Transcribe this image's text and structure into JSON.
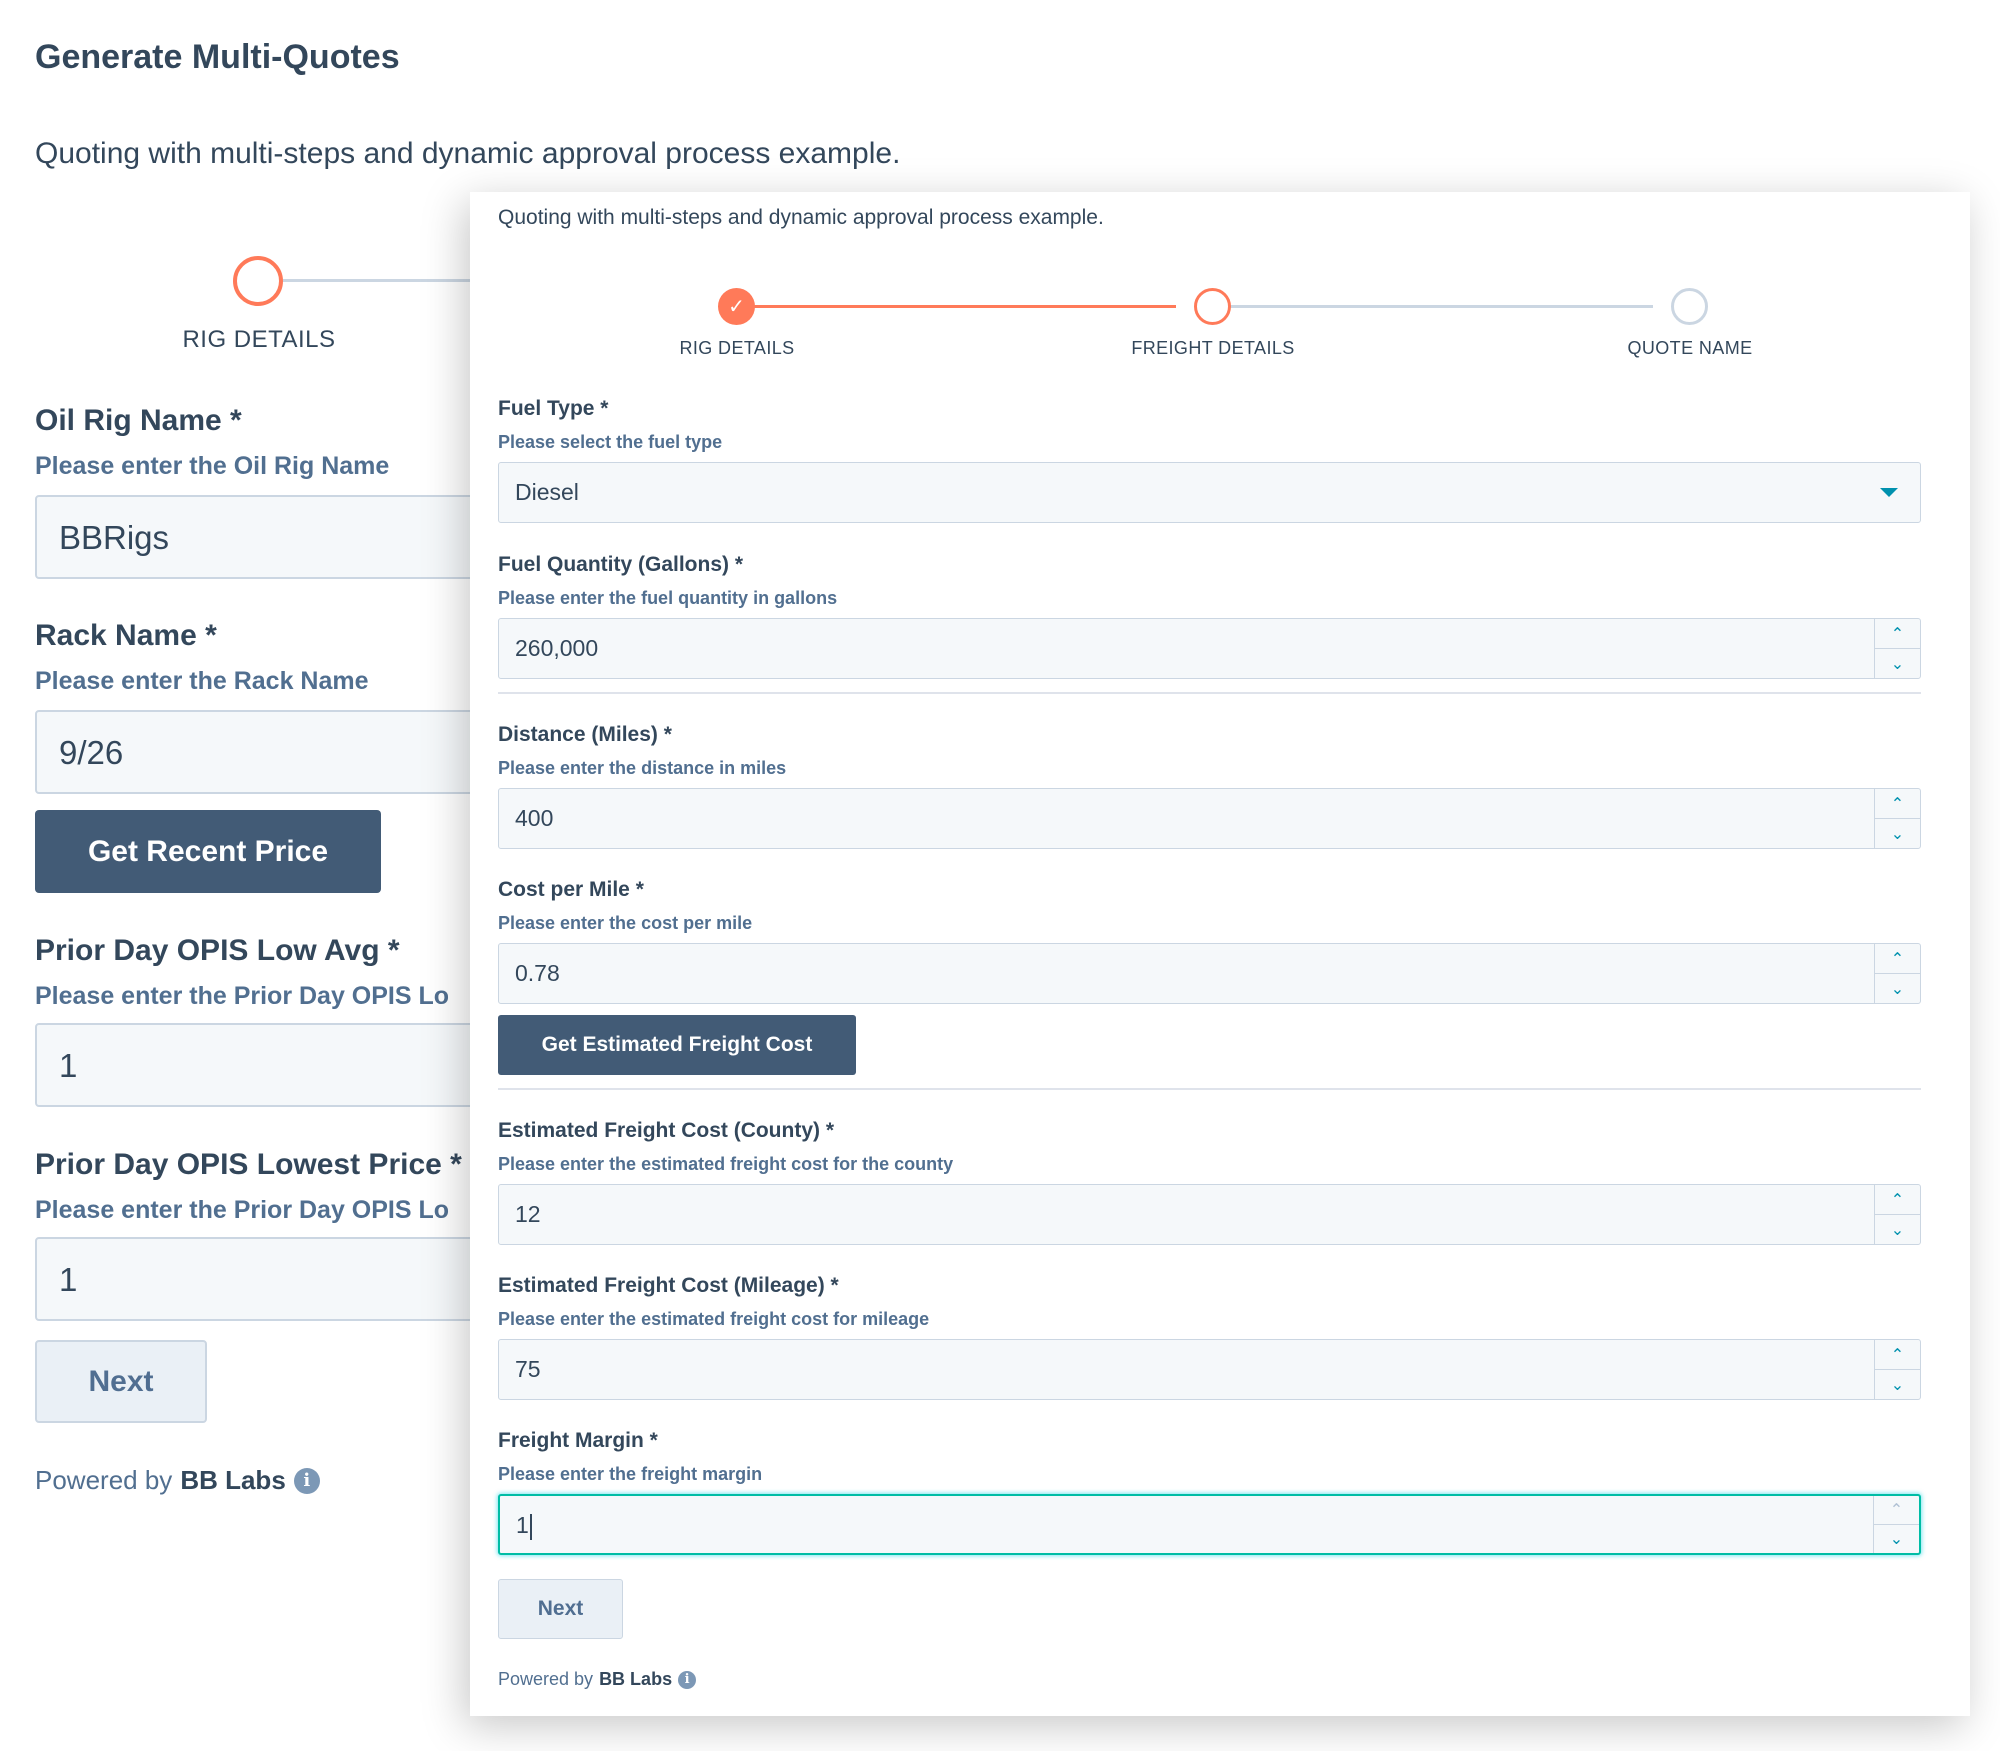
{
  "background_form": {
    "title": "Generate Multi-Quotes",
    "subtitle": "Quoting with multi-steps and dynamic approval process example.",
    "step_label": "RIG DETAILS",
    "fields": {
      "oil_rig_name": {
        "label": "Oil Rig Name *",
        "help": "Please enter the Oil Rig Name",
        "value": "BBRigs"
      },
      "rack_name": {
        "label": "Rack Name *",
        "help": "Please enter the Rack Name",
        "value": "9/26"
      },
      "opis_low_avg": {
        "label": "Prior Day OPIS Low Avg *",
        "help": "Please enter the Prior Day OPIS Lo",
        "value": "1"
      },
      "opis_lowest_price": {
        "label": "Prior Day OPIS Lowest Price *",
        "help": "Please enter the Prior Day OPIS Lo",
        "value": "1"
      }
    },
    "get_recent_price_label": "Get Recent Price",
    "next_label": "Next",
    "powered_prefix": "Powered by",
    "powered_brand": "BB Labs"
  },
  "popup_form": {
    "subtitle": "Quoting with multi-steps and dynamic approval process example.",
    "steps": [
      {
        "label": "RIG DETAILS",
        "state": "complete"
      },
      {
        "label": "FREIGHT DETAILS",
        "state": "active"
      },
      {
        "label": "QUOTE NAME",
        "state": "pending"
      }
    ],
    "fields": {
      "fuel_type": {
        "label": "Fuel Type *",
        "help": "Please select the fuel type",
        "value": "Diesel"
      },
      "fuel_quantity": {
        "label": "Fuel Quantity (Gallons) *",
        "help": "Please enter the fuel quantity in gallons",
        "value": "260,000"
      },
      "distance": {
        "label": "Distance (Miles) *",
        "help": "Please enter the distance in miles",
        "value": "400"
      },
      "cost_per_mile": {
        "label": "Cost per Mile *",
        "help": "Please enter the cost per mile",
        "value": "0.78"
      },
      "freight_cost_county": {
        "label": "Estimated Freight Cost (County) *",
        "help": "Please enter the estimated freight cost for the county",
        "value": "12"
      },
      "freight_cost_mileage": {
        "label": "Estimated Freight Cost (Mileage) *",
        "help": "Please enter the estimated freight cost for mileage",
        "value": "75"
      },
      "freight_margin": {
        "label": "Freight Margin *",
        "help": "Please enter the freight margin",
        "value": "1"
      }
    },
    "get_estimated_freight_cost_label": "Get Estimated Freight Cost",
    "next_label": "Next",
    "powered_prefix": "Powered by",
    "powered_brand": "BB Labs"
  },
  "icons": {
    "info": "i",
    "check": "✓",
    "chevron_up": "⌃",
    "chevron_down": "⌄"
  },
  "colors": {
    "accent_orange": "#ff7a59",
    "primary_button": "#425b76",
    "focus_teal": "#00bda5",
    "spinner_arrow": "#0091ae"
  }
}
